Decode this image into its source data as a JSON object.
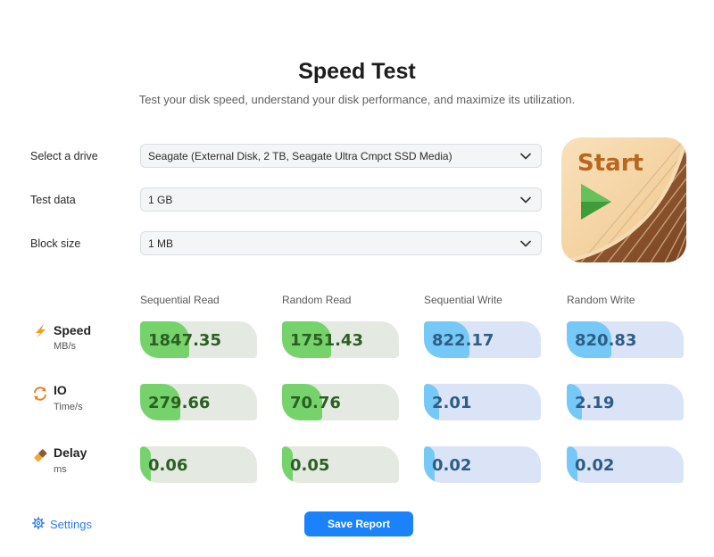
{
  "header": {
    "title": "Speed Test",
    "subtitle": "Test your disk speed, understand your disk performance, and maximize its utilization."
  },
  "form": {
    "drive": {
      "label": "Select a drive",
      "value": "Seagate (External Disk, 2 TB, Seagate Ultra Cmpct SSD Media)"
    },
    "test_data": {
      "label": "Test data",
      "value": "1 GB"
    },
    "block_size": {
      "label": "Block size",
      "value": "1 MB"
    }
  },
  "start_button": {
    "label": "Start"
  },
  "columns": [
    "Sequential Read",
    "Random Read",
    "Sequential Write",
    "Random Write"
  ],
  "metrics": [
    {
      "name": "Speed",
      "unit": "MB/s",
      "icon": "lightning-icon",
      "values": [
        "1847.35",
        "1751.43",
        "822.17",
        "820.83"
      ],
      "fill_fraction": [
        0.42,
        0.42,
        0.39,
        0.38
      ]
    },
    {
      "name": "IO",
      "unit": "Time/s",
      "icon": "refresh-cycle-icon",
      "values": [
        "279.66",
        "70.76",
        "2.01",
        "2.19"
      ],
      "fill_fraction": [
        0.34,
        0.34,
        0.13,
        0.13
      ]
    },
    {
      "name": "Delay",
      "unit": "ms",
      "icon": "eraser-icon",
      "values": [
        "0.06",
        "0.05",
        "0.02",
        "0.02"
      ],
      "fill_fraction": [
        0.09,
        0.09,
        0.09,
        0.09
      ]
    }
  ],
  "footer": {
    "settings_label": "Settings",
    "save_report_label": "Save Report"
  },
  "colors": {
    "read_fill": "#76d36b",
    "read_track": "#e4e9e1",
    "write_fill": "#76c9f7",
    "write_track": "#dbe4f6",
    "accent": "#1a82fb",
    "start_text": "#b8671e"
  }
}
